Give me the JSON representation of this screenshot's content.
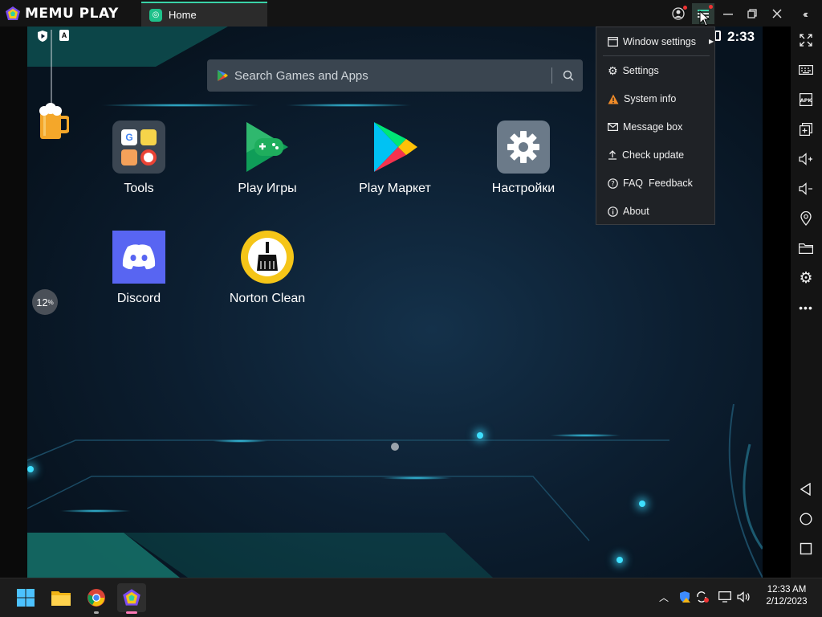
{
  "app": {
    "logo_text": "MEMU PLAY"
  },
  "tabs": [
    {
      "label": "Home"
    }
  ],
  "screen": {
    "status": {
      "clock": "2:33",
      "shield_badge": "",
      "a_badge": "A"
    },
    "search": {
      "placeholder": "Search Games and Apps"
    },
    "apps": [
      {
        "label": "Tools"
      },
      {
        "label": "Play Игры"
      },
      {
        "label": "Play Маркет"
      },
      {
        "label": "Настройки"
      },
      {
        "label": "Discord"
      },
      {
        "label": "Norton Clean"
      }
    ],
    "cpu_percent": "12",
    "cpu_unit": "%"
  },
  "menu": {
    "items": [
      {
        "label": "Window settings"
      },
      {
        "label": "Settings"
      },
      {
        "label": "System info"
      },
      {
        "label": "Message box"
      },
      {
        "label": "Check update"
      },
      {
        "label": "FAQ  Feedback"
      },
      {
        "label": "About"
      }
    ]
  },
  "taskbar": {
    "time": "12:33 AM",
    "date": "2/12/2023"
  },
  "colors": {
    "accent": "#3ad3a8",
    "warning": "#f28c28",
    "discord": "#5865f2",
    "norton": "#f5c518"
  }
}
